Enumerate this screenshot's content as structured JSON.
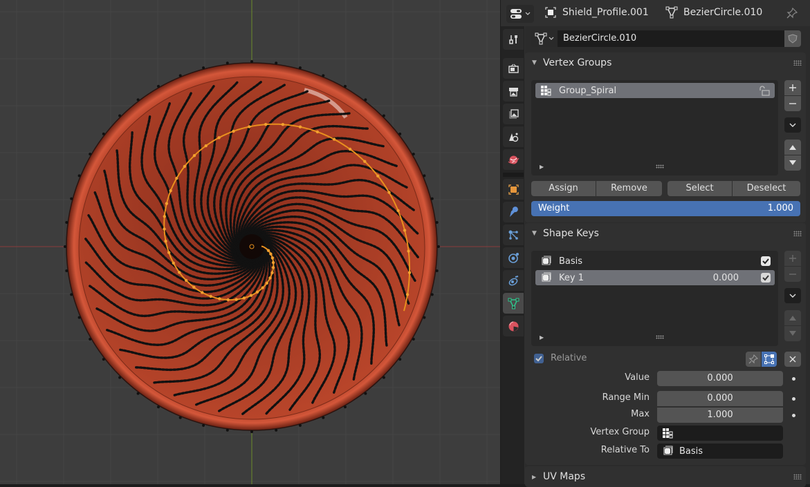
{
  "viewport": {
    "object_name": "BezierCircle.010",
    "mode": "edit",
    "colors": {
      "background": "#3d3d3d",
      "grid": "#454545",
      "x_axis": "#8b3a3a",
      "y_axis": "#6b8a2a",
      "mesh_face": "#b8452a",
      "mesh_rim": "#c24a2c",
      "vertex": "#111111",
      "selected_curve": "#e8901e"
    }
  },
  "header": {
    "editor_type_icon": "properties-editor-icon",
    "object_label": "Shield_Profile.001",
    "data_label": "BezierCircle.010",
    "pin_icon": "pin-icon"
  },
  "tabs": [
    {
      "name": "tool",
      "icon": "tool-icon",
      "active": false
    },
    {
      "name": "render",
      "icon": "render-icon",
      "active": false
    },
    {
      "name": "output",
      "icon": "output-icon",
      "active": false
    },
    {
      "name": "view-layer",
      "icon": "view-layer-icon",
      "active": false
    },
    {
      "name": "scene",
      "icon": "scene-icon",
      "active": false
    },
    {
      "name": "world",
      "icon": "world-icon",
      "active": false
    },
    {
      "name": "object",
      "icon": "object-icon",
      "active": false
    },
    {
      "name": "modifiers",
      "icon": "wrench-icon",
      "active": false
    },
    {
      "name": "particles",
      "icon": "particles-icon",
      "active": false
    },
    {
      "name": "physics",
      "icon": "physics-icon",
      "active": false
    },
    {
      "name": "constraints",
      "icon": "constraints-icon",
      "active": false
    },
    {
      "name": "data",
      "icon": "mesh-data-icon",
      "active": true
    },
    {
      "name": "material",
      "icon": "material-icon",
      "active": false
    }
  ],
  "datablock": {
    "name": "BezierCircle.010"
  },
  "vertex_groups": {
    "title": "Vertex Groups",
    "items": [
      {
        "name": "Group_Spiral",
        "selected": true,
        "locked": false
      }
    ],
    "buttons": {
      "assign": "Assign",
      "remove": "Remove",
      "select": "Select",
      "deselect": "Deselect"
    },
    "weight_label": "Weight",
    "weight_value": "1.000"
  },
  "shape_keys": {
    "title": "Shape Keys",
    "items": [
      {
        "name": "Basis",
        "value": "",
        "enabled": true,
        "selected": false
      },
      {
        "name": "Key 1",
        "value": "0.000",
        "enabled": true,
        "selected": true
      }
    ],
    "relative_label": "Relative",
    "relative_checked": true,
    "value_label": "Value",
    "value": "0.000",
    "range_min_label": "Range Min",
    "range_min": "0.000",
    "max_label": "Max",
    "max": "1.000",
    "vertex_group_label": "Vertex Group",
    "vertex_group_value": "",
    "relative_to_label": "Relative To",
    "relative_to_value": "Basis"
  },
  "uv_maps": {
    "title": "UV Maps",
    "collapsed": true
  }
}
